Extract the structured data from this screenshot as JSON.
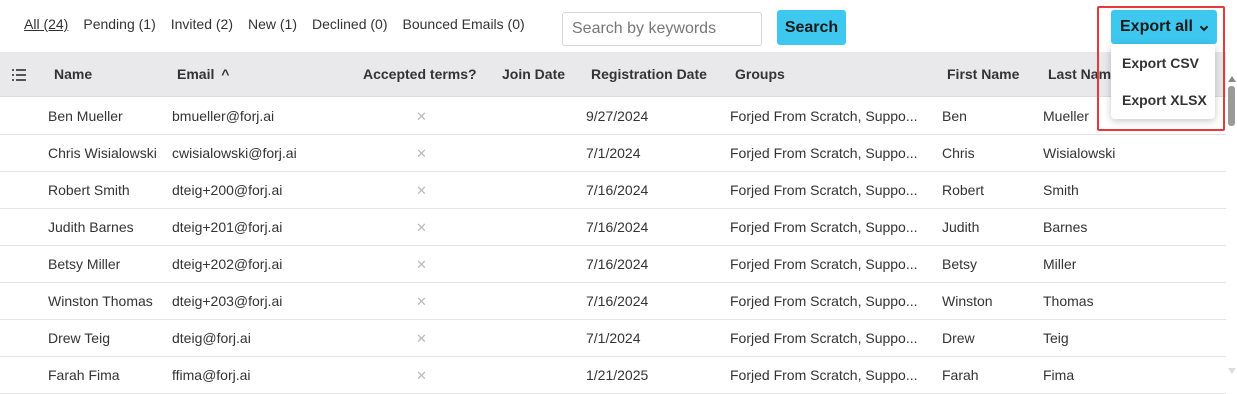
{
  "filters": [
    {
      "label": "All (24)",
      "active": true
    },
    {
      "label": "Pending (1)",
      "active": false
    },
    {
      "label": "Invited (2)",
      "active": false
    },
    {
      "label": "New (1)",
      "active": false
    },
    {
      "label": "Declined (0)",
      "active": false
    },
    {
      "label": "Bounced Emails (0)",
      "active": false
    }
  ],
  "search": {
    "placeholder": "Search by keywords",
    "button_label": "Search"
  },
  "export": {
    "button_label": "Export all",
    "menu": [
      "Export CSV",
      "Export XLSX"
    ]
  },
  "columns": {
    "name": "Name",
    "email": "Email",
    "sort_indicator": "^",
    "accepted_terms": "Accepted terms?",
    "join_date": "Join Date",
    "registration_date": "Registration Date",
    "groups": "Groups",
    "first_name": "First Name",
    "last_name": "Last Name"
  },
  "icons": {
    "column_picker": "list-settings-icon",
    "not_accepted": "x-icon",
    "menu_chevron": "chevron-down-icon"
  },
  "rows": [
    {
      "name": "Ben Mueller",
      "email": "bmueller@forj.ai",
      "accepted": "✕",
      "join_date": "",
      "registration_date": "9/27/2024",
      "groups": "Forjed From Scratch,  Suppo...",
      "first_name": "Ben",
      "last_name": "Mueller"
    },
    {
      "name": "Chris Wisialowski",
      "email": "cwisialowski@forj.ai",
      "accepted": "✕",
      "join_date": "",
      "registration_date": "7/1/2024",
      "groups": "Forjed From Scratch,  Suppo...",
      "first_name": "Chris",
      "last_name": "Wisialowski"
    },
    {
      "name": "Robert Smith",
      "email": "dteig+200@forj.ai",
      "accepted": "✕",
      "join_date": "",
      "registration_date": "7/16/2024",
      "groups": "Forjed From Scratch,  Suppo...",
      "first_name": "Robert",
      "last_name": "Smith"
    },
    {
      "name": "Judith Barnes",
      "email": "dteig+201@forj.ai",
      "accepted": "✕",
      "join_date": "",
      "registration_date": "7/16/2024",
      "groups": "Forjed From Scratch,  Suppo...",
      "first_name": "Judith",
      "last_name": "Barnes"
    },
    {
      "name": "Betsy Miller",
      "email": "dteig+202@forj.ai",
      "accepted": "✕",
      "join_date": "",
      "registration_date": "7/16/2024",
      "groups": "Forjed From Scratch,  Suppo...",
      "first_name": "Betsy",
      "last_name": "Miller"
    },
    {
      "name": "Winston Thomas",
      "email": "dteig+203@forj.ai",
      "accepted": "✕",
      "join_date": "",
      "registration_date": "7/16/2024",
      "groups": "Forjed From Scratch,  Suppo...",
      "first_name": "Winston",
      "last_name": "Thomas"
    },
    {
      "name": "Drew Teig",
      "email": "dteig@forj.ai",
      "accepted": "✕",
      "join_date": "",
      "registration_date": "7/1/2024",
      "groups": "Forjed From Scratch,  Suppo...",
      "first_name": "Drew",
      "last_name": "Teig"
    },
    {
      "name": "Farah Fima",
      "email": "ffima@forj.ai",
      "accepted": "✕",
      "join_date": "",
      "registration_date": "1/21/2025",
      "groups": "Forjed From Scratch,  Suppo...",
      "first_name": "Farah",
      "last_name": "Fima"
    }
  ],
  "colors": {
    "accent": "#3ec8ef",
    "highlight_frame": "#e5393b",
    "header_bg": "#e9e9eb"
  }
}
